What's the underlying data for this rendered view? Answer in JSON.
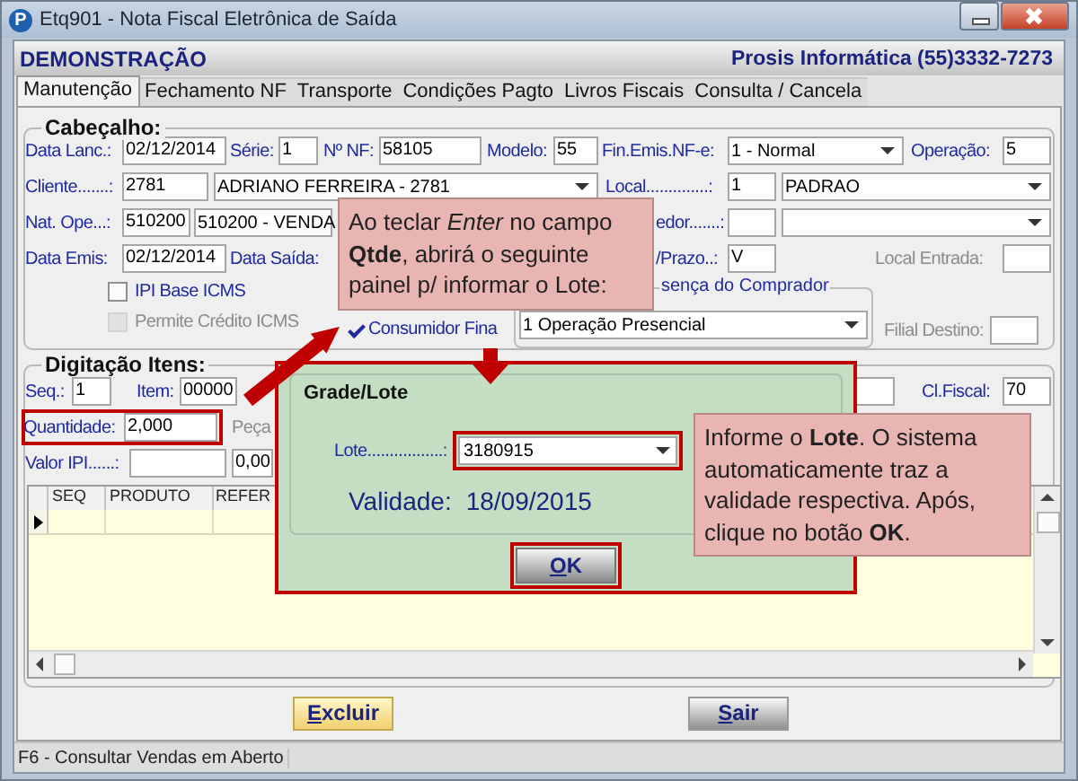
{
  "window": {
    "logo": "P",
    "title": "Etq901 - Nota Fiscal Eletrônica de Saída"
  },
  "banner": {
    "company": "DEMONSTRAÇÃO",
    "contact": "Prosis Informática (55)3332-7273"
  },
  "tabs": [
    {
      "label": "Manutenção",
      "selected": true
    },
    {
      "label": "Fechamento NF",
      "selected": false
    },
    {
      "label": "Transporte",
      "selected": false
    },
    {
      "label": "Condições Pagto",
      "selected": false
    },
    {
      "label": "Livros Fiscais",
      "selected": false
    },
    {
      "label": "Consulta / Cancela",
      "selected": false
    }
  ],
  "header_group": {
    "title": "Cabeçalho:",
    "rows": [
      {
        "items": [
          {
            "kind": "label",
            "text": "Data Lanc.:"
          },
          {
            "kind": "field",
            "text": "02/12/2014"
          },
          {
            "kind": "label",
            "text": "Série:"
          },
          {
            "kind": "field",
            "text": "1"
          },
          {
            "kind": "label",
            "text": "Nº NF:"
          },
          {
            "kind": "field",
            "text": "58105"
          },
          {
            "kind": "label",
            "text": "Modelo:"
          },
          {
            "kind": "field",
            "text": "55"
          },
          {
            "kind": "label",
            "text": "Fin.Emis.NF-e:"
          },
          {
            "kind": "select",
            "text": "1 - Normal"
          },
          {
            "kind": "label",
            "text": "Operação:"
          },
          {
            "kind": "field",
            "text": "5"
          }
        ]
      },
      {
        "items": [
          {
            "kind": "label",
            "text": "Cliente.......:"
          },
          {
            "kind": "field",
            "text": "2781"
          },
          {
            "kind": "select",
            "text": "ADRIANO FERREIRA - 2781"
          },
          {
            "kind": "label",
            "text": "Local..............:"
          },
          {
            "kind": "field",
            "text": "1"
          },
          {
            "kind": "select",
            "text": "PADRAO"
          }
        ]
      },
      {
        "items": [
          {
            "kind": "label",
            "text": "Nat. Ope...:"
          },
          {
            "kind": "field",
            "text": "510200"
          },
          {
            "kind": "cut_select",
            "text": "510200 - VENDA"
          },
          {
            "kind": "label",
            "text": "edor.......:"
          },
          {
            "kind": "field"
          },
          {
            "kind": "select"
          }
        ]
      },
      {
        "items": [
          {
            "kind": "label",
            "text": "Data Emis:"
          },
          {
            "kind": "field",
            "text": "02/12/2014"
          },
          {
            "kind": "label",
            "text": "Data Saída:"
          },
          {
            "kind": "label",
            "text": "/Prazo..:"
          },
          {
            "kind": "field",
            "text": "V"
          },
          {
            "kind": "dim_label",
            "text": "Local Entrada:"
          },
          {
            "kind": "field"
          }
        ]
      }
    ],
    "checks": [
      {
        "label": "IPI Base ICMS",
        "checked": false,
        "disabled": false
      },
      {
        "label": "Permite Crédito ICMS",
        "checked": false,
        "disabled": true
      }
    ],
    "consumer_check": {
      "label": "Consumidor Fina",
      "checked": true
    },
    "presence_group": {
      "title": "sença do Comprador",
      "value": "1 Operação Presencial"
    },
    "branch": {
      "label": "Filial Destino:"
    }
  },
  "items_group": {
    "title": "Digitação Itens:",
    "rows": [
      {
        "highlighted": false,
        "items": [
          {
            "kind": "label",
            "text": "Seq.:"
          },
          {
            "kind": "field",
            "text": "1"
          },
          {
            "kind": "label",
            "text": "Item:"
          },
          {
            "kind": "field",
            "text": "00000"
          },
          {
            "kind": "field"
          },
          {
            "kind": "label",
            "text": "Cl.Fiscal:"
          },
          {
            "kind": "field",
            "text": "70"
          }
        ]
      },
      {
        "highlighted": true,
        "items": [
          {
            "kind": "label",
            "text": "Quantidade:"
          },
          {
            "kind": "field",
            "text": "2,000"
          },
          {
            "kind": "dim_label",
            "text": "Peça"
          }
        ]
      },
      {
        "highlighted": false,
        "items": [
          {
            "kind": "label",
            "text": "Valor IPI......:"
          },
          {
            "kind": "field"
          },
          {
            "kind": "field",
            "text": "0,00"
          }
        ]
      }
    ],
    "table": {
      "columns": [
        "SEQ",
        "PRODUTO",
        "REFER"
      ],
      "rows": [
        {
          "selected": true
        }
      ]
    }
  },
  "buttons": [
    {
      "label": "Excluir",
      "kind": "accent"
    },
    {
      "label": "Sair",
      "kind": "normal"
    }
  ],
  "status_bar": {
    "text": "F6 - Consultar Vendas em Aberto"
  },
  "dialog": {
    "title": "Grade/Lote",
    "lote_label": "Lote.................:",
    "lote_value": "3180915",
    "validade_label": "Validade:",
    "validade_value": "18/09/2015",
    "ok": {
      "label": "OK"
    }
  },
  "callouts": [
    {
      "text": "Ao teclar *Enter* no campo **Qtde**, abrirá o seguinte painel p/ informar o Lote:"
    },
    {
      "text": "Informe o **Lote**. O sistema automaticamente traz a validade respectiva.  Após, clique no botão **OK**."
    }
  ]
}
